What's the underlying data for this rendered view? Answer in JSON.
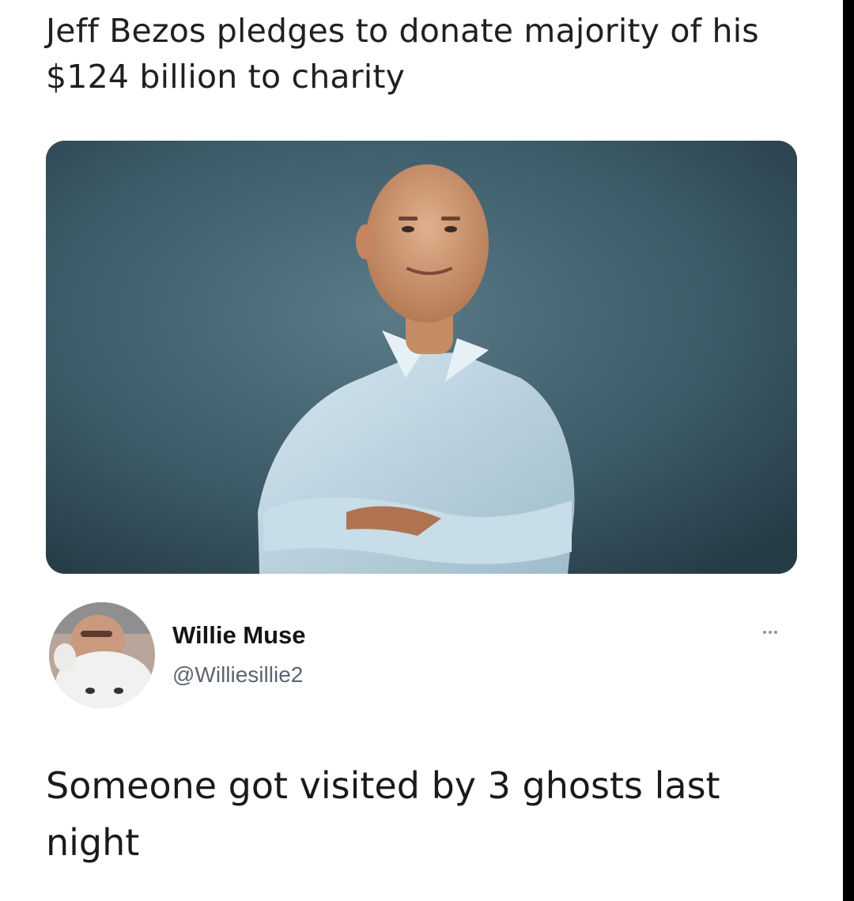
{
  "post": {
    "headline": "Jeff Bezos pledges to donate majority of his $124 billion to charity",
    "photo_icon": "portrait-photo"
  },
  "tweet": {
    "author": {
      "display_name": "Willie Muse",
      "handle": "@Williesillie2",
      "avatar_icon": "avatar-photo"
    },
    "more_icon": "ellipsis-icon",
    "text": "Someone got visited by 3 ghosts last night"
  },
  "colors": {
    "background": "#ffffff",
    "text": "#202020",
    "handle": "#5b6570",
    "photo_backdrop": "#3b5865",
    "shirt": "#b9d3e2"
  }
}
